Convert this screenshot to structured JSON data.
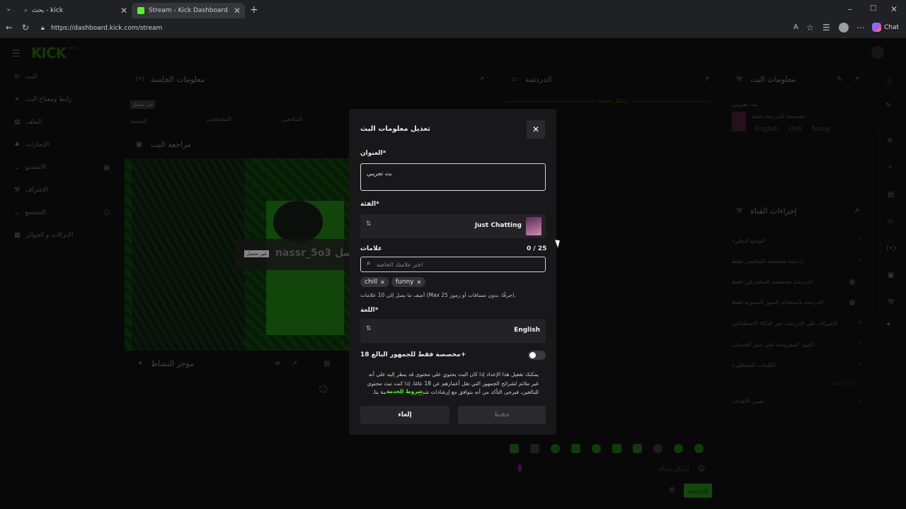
{
  "browser": {
    "tabs": [
      {
        "label": "بحث - kick"
      },
      {
        "label": "Stream - Kick Dashboard"
      }
    ],
    "url": "https://dashboard.kick.com/stream",
    "chat_label": "Chat"
  },
  "sidebar": {
    "logo": "KICK",
    "logo_badge": "BETA",
    "items": [
      {
        "label": "البث"
      },
      {
        "label": "رابط ومفتاح البث"
      },
      {
        "label": "الملف"
      },
      {
        "label": "الإنجازات"
      },
      {
        "label": "الاستديو"
      },
      {
        "label": "الإشراف"
      },
      {
        "label": "المجتمع"
      },
      {
        "label": "الإنزالات و الجوائز"
      }
    ]
  },
  "panels": {
    "session": {
      "title": "معلومات الجلسة",
      "badge": "غير متصل",
      "stats": [
        "الجلسة",
        "المشاهدين",
        "المتابعين"
      ]
    },
    "preview": {
      "title": "مراجعة البث",
      "offline_badge": "غير متصل",
      "channel": "nassr_5o3 بث حصل"
    },
    "activity": {
      "title": "موجز النشاط"
    },
    "chat": {
      "title": "الدردشة",
      "new_messages": "رسائل جديدة",
      "send_label": "الدردشة",
      "input_placeholder": "إرسال رسالة"
    },
    "stream_info": {
      "title": "معلومات البث",
      "stream_title": "بث تجريبي",
      "subtitle": "مخصصة للدردشة فقط",
      "tags": [
        "English",
        "chill",
        "funny"
      ]
    },
    "channel_actions": {
      "title": "إجراءات القناة",
      "items": [
        {
          "label": "الوضع البطيء"
        },
        {
          "label": "دردشة مخصصة للمتابعين فقط"
        },
        {
          "label": "الدردشة مخصصة للمشتركين فقط"
        },
        {
          "label": "الدردشة باستخدام الصور التعبيرية فقط"
        },
        {
          "label": "الإشراف على الدردشة عبر الذكاء الاصطناعي"
        },
        {
          "label": "القيود المفروضة على عمر الحساب"
        },
        {
          "label": "الكلمات المحظورة"
        },
        {
          "label": "تعيين الأهداف"
        }
      ],
      "section": "إدارة القناة"
    }
  },
  "modal": {
    "title": "تعديل معلومات البث",
    "title_label": "العنوان*",
    "title_value": "بث تجريبي",
    "category_label": "الفئة*",
    "category_value": "Just Chatting",
    "tags_label": "علامات",
    "tags_count": "0 / 25",
    "tags_placeholder": "اختر علامتك الخاصة",
    "tags": [
      "chill",
      "funny"
    ],
    "tags_hint": "أضف ما يصل إلى 10 علامات (Max 25 حرفًا، بدون مسافات أو رموز).",
    "language_label": "اللغة*",
    "language_value": "English",
    "mature_label": "مخصصة فقط للجمهور البالغ 18+",
    "mature_description": "يمكنك تفعيل هذا الإعداد إذا كان البث يحتوي على محتوى قد ينظر إليه على أنه غير ملائم لشرائح الجمهور التي تقل أعمارهم عن 18 عامًا. إذا كنت تبث محتوى للبالغين، فيرجى التأكد من أنه يتوافق مع إرشادات شروط الخدمة الخاصة بنا.",
    "terms_link": "شروط الخدمة",
    "cancel_label": "إلغاء",
    "save_label": "حفظ"
  }
}
